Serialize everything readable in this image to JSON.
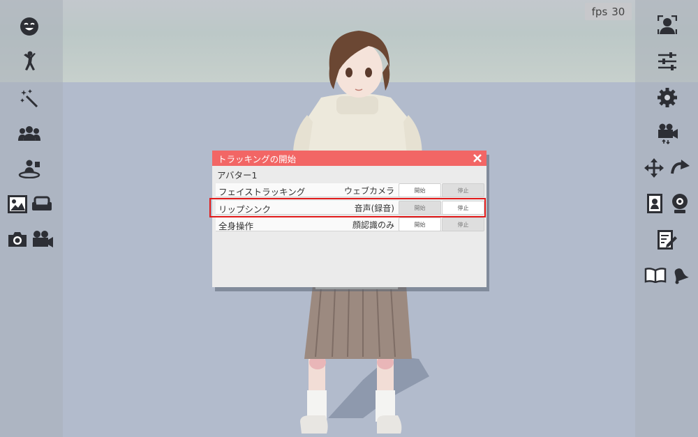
{
  "colors": {
    "dialog_header": "#f26665",
    "highlight": "#e11b1b",
    "sidebar_icon": "#2d2f35"
  },
  "fps": {
    "label": "fps",
    "value": "30"
  },
  "left_toolbar": [
    {
      "icon": "face-expression-icon"
    },
    {
      "icon": "pose-icon"
    },
    {
      "icon": "magic-wand-effects-icon"
    },
    {
      "icon": "group-icon"
    },
    {
      "icon": "stage-icon"
    },
    {
      "icon": "background-image-icon"
    },
    {
      "icon": "sofa-icon"
    },
    {
      "icon": "camera-icon"
    },
    {
      "icon": "video-camera-icon"
    }
  ],
  "right_toolbar": [
    {
      "icon": "face-tracking-icon"
    },
    {
      "icon": "sliders-icon"
    },
    {
      "icon": "gear-icon"
    },
    {
      "icon": "camera-switch-icon"
    },
    {
      "icon": "move-arrows-icon"
    },
    {
      "icon": "rotate-icon"
    },
    {
      "icon": "portrait-icon"
    },
    {
      "icon": "webcam-icon"
    },
    {
      "icon": "edit-note-icon"
    },
    {
      "icon": "book-icon"
    },
    {
      "icon": "bell-icon"
    }
  ],
  "dialog": {
    "title": "トラッキングの開始",
    "close_icon": "close-icon",
    "avatar_label": "アバター1",
    "rows": [
      {
        "name": "フェイストラッキング",
        "source": "ウェブカメラ",
        "start": "開始",
        "stop": "停止",
        "active": false
      },
      {
        "name": "リップシンク",
        "source": "音声(録音)",
        "start": "開始",
        "stop": "停止",
        "active": true
      },
      {
        "name": "全身操作",
        "source": "顔認識のみ",
        "start": "開始",
        "stop": "停止",
        "active": false
      }
    ]
  }
}
